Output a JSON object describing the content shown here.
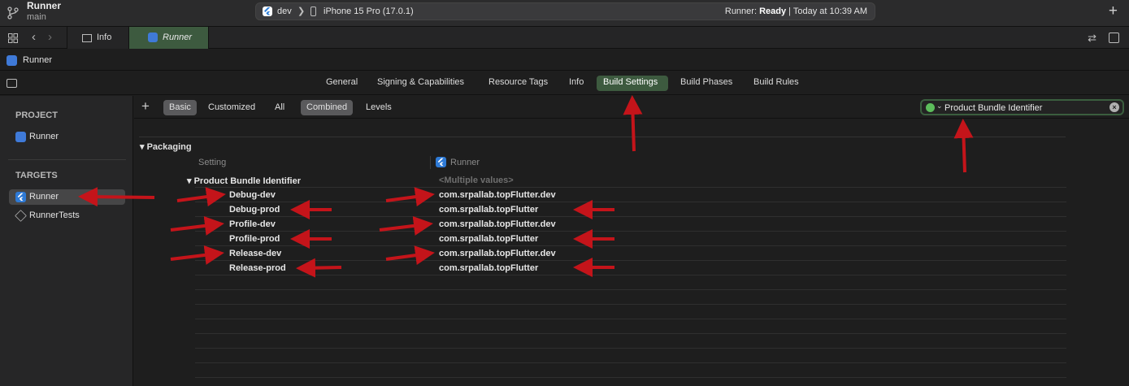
{
  "titlebar": {
    "project": "Runner",
    "branch": "main",
    "scheme": "dev",
    "device": "iPhone 15 Pro (17.0.1)",
    "status_prefix": "Runner: ",
    "status_state": "Ready",
    "status_suffix": " | Today at 10:39 AM"
  },
  "tabs": [
    {
      "label": "Info"
    },
    {
      "label": "Runner"
    }
  ],
  "jumpbar": {
    "label": "Runner"
  },
  "editor_tabs": [
    {
      "label": "General"
    },
    {
      "label": "Signing & Capabilities"
    },
    {
      "label": "Resource Tags"
    },
    {
      "label": "Info"
    },
    {
      "label": "Build Settings"
    },
    {
      "label": "Build Phases"
    },
    {
      "label": "Build Rules"
    }
  ],
  "sidebar": {
    "project_heading": "PROJECT",
    "project_item": "Runner",
    "targets_heading": "TARGETS",
    "targets": [
      {
        "label": "Runner"
      },
      {
        "label": "RunnerTests"
      }
    ]
  },
  "filterbar": {
    "basic": "Basic",
    "customized": "Customized",
    "all": "All",
    "combined": "Combined",
    "levels": "Levels",
    "search_value": "Product Bundle Identifier"
  },
  "settings": {
    "section": "Packaging",
    "col_setting": "Setting",
    "col_target": "Runner",
    "group_label": "Product Bundle Identifier",
    "group_value": "<Multiple values>",
    "rows": [
      {
        "config": "Debug-dev",
        "value": "com.srpallab.topFlutter.dev"
      },
      {
        "config": "Debug-prod",
        "value": "com.srpallab.topFlutter"
      },
      {
        "config": "Profile-dev",
        "value": "com.srpallab.topFlutter.dev"
      },
      {
        "config": "Profile-prod",
        "value": "com.srpallab.topFlutter"
      },
      {
        "config": "Release-dev",
        "value": "com.srpallab.topFlutter.dev"
      },
      {
        "config": "Release-prod",
        "value": "com.srpallab.topFlutter"
      }
    ]
  },
  "colors": {
    "accent_green": "#3d5a3f",
    "annotation_red": "#c4141a"
  }
}
